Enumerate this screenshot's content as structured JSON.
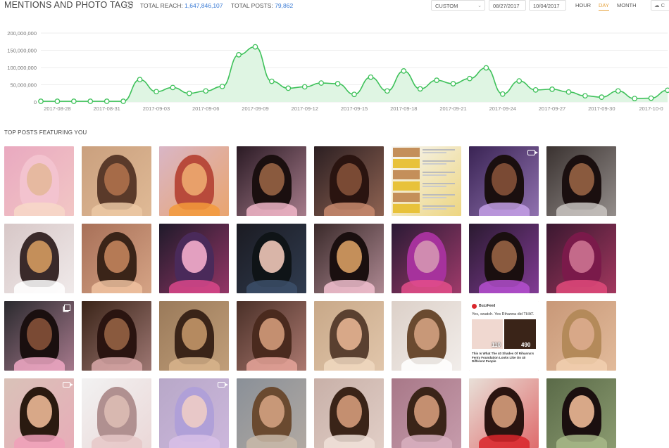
{
  "header": {
    "title": "MENTIONS AND PHOTO TAGS",
    "info_icon": "info-icon",
    "total_reach_label": "TOTAL REACH:",
    "total_reach_value": "1,647,846,107",
    "total_posts_label": "TOTAL POSTS:",
    "total_posts_value": "79,862",
    "range_select": "CUSTOM",
    "date_from": "08/27/2017",
    "date_to": "10/04/2017",
    "granularity": [
      "HOUR",
      "DAY",
      "MONTH"
    ],
    "granularity_active": "DAY",
    "download_label": "C"
  },
  "colors": {
    "accent": "#e6a23c",
    "link": "#3a7bd5",
    "line": "#3ec15a",
    "fill": "#dff5e3"
  },
  "chart_data": {
    "type": "area",
    "title": "",
    "xlabel": "",
    "ylabel": "",
    "ylim": [
      0,
      200000000
    ],
    "yticks": [
      "0",
      "50,000,000",
      "100,000,000",
      "150,000,000",
      "200,000,000"
    ],
    "ytick_values": [
      0,
      50000000,
      100000000,
      150000000,
      200000000
    ],
    "x": [
      "2017-08-27",
      "2017-08-28",
      "2017-08-29",
      "2017-08-30",
      "2017-08-31",
      "2017-09-01",
      "2017-09-02",
      "2017-09-03",
      "2017-09-04",
      "2017-09-05",
      "2017-09-06",
      "2017-09-07",
      "2017-09-08",
      "2017-09-09",
      "2017-09-10",
      "2017-09-11",
      "2017-09-12",
      "2017-09-13",
      "2017-09-14",
      "2017-09-15",
      "2017-09-16",
      "2017-09-17",
      "2017-09-18",
      "2017-09-19",
      "2017-09-20",
      "2017-09-21",
      "2017-09-22",
      "2017-09-23",
      "2017-09-24",
      "2017-09-25",
      "2017-09-26",
      "2017-09-27",
      "2017-09-28",
      "2017-09-29",
      "2017-09-30",
      "2017-10-01",
      "2017-10-02",
      "2017-10-03",
      "2017-10-04"
    ],
    "xtick_labels": [
      "2017-08-28",
      "2017-08-31",
      "2017-09-03",
      "2017-09-06",
      "2017-09-09",
      "2017-09-12",
      "2017-09-15",
      "2017-09-18",
      "2017-09-21",
      "2017-09-24",
      "2017-09-27",
      "2017-09-30",
      "2017-10-0"
    ],
    "series": [
      {
        "values": [
          2000000,
          2000000,
          2000000,
          2000000,
          2000000,
          2000000,
          65000000,
          30000000,
          42000000,
          25000000,
          32000000,
          45000000,
          137000000,
          160000000,
          60000000,
          40000000,
          44000000,
          55000000,
          53000000,
          22000000,
          72000000,
          32000000,
          90000000,
          38000000,
          63000000,
          53000000,
          68000000,
          99000000,
          23000000,
          61000000,
          35000000,
          37000000,
          29000000,
          18000000,
          14000000,
          32000000,
          10000000,
          11000000,
          34000000
        ]
      }
    ],
    "grid": true,
    "legend": "none"
  },
  "section": {
    "title": "TOP POSTS FEATURING YOU"
  },
  "posts": [
    {
      "label": "post-1",
      "bg": "#e9a9c0",
      "accent": "#f7d8c8",
      "skin": "#e6b9a0",
      "hair": "#f3c3cf",
      "badge": ""
    },
    {
      "label": "post-2",
      "bg": "#caa07e",
      "accent": "#ecc9a4",
      "skin": "#a66b48",
      "hair": "#5a3a2a",
      "badge": ""
    },
    {
      "label": "post-3",
      "bg": "#d9b6c6",
      "accent": "#f39a3b",
      "skin": "#e8a06a",
      "hair": "#b84a3b",
      "badge": ""
    },
    {
      "label": "post-4",
      "bg": "#2a1a24",
      "accent": "#f1b6c8",
      "skin": "#8a5a3e",
      "hair": "#1a0f0f",
      "badge": ""
    },
    {
      "label": "post-5",
      "bg": "#2c1f22",
      "accent": "#c98b6e",
      "skin": "#7a4a34",
      "hair": "#2a1410",
      "badge": ""
    },
    {
      "label": "post-6",
      "bg": "#f6f6f6",
      "accent": "#e8c23a",
      "skin": "#c48f5a",
      "hair": "#8b5a2b",
      "badge": "list"
    },
    {
      "label": "post-7",
      "bg": "#3a2454",
      "accent": "#c4a0e6",
      "skin": "#7a4a34",
      "hair": "#1a0f0f",
      "badge": "cam"
    },
    {
      "label": "post-8",
      "bg": "#3a3230",
      "accent": "#c9c4c1",
      "skin": "#8a5a3e",
      "hair": "#1a0f0f",
      "badge": ""
    },
    {
      "label": "post-9",
      "bg": "#d7c7c7",
      "accent": "#ffffff",
      "skin": "#c48f5a",
      "hair": "#3a2a2a",
      "badge": ""
    },
    {
      "label": "post-10",
      "bg": "#a87058",
      "accent": "#f0c2a0",
      "skin": "#b57a55",
      "hair": "#3a2418",
      "badge": ""
    },
    {
      "label": "post-11",
      "bg": "#1f1a2a",
      "accent": "#d9468a",
      "skin": "#e3a0c0",
      "hair": "#4a2a5a",
      "badge": ""
    },
    {
      "label": "post-12",
      "bg": "#1b1b22",
      "accent": "#3c4f6a",
      "skin": "#d9b5a8",
      "hair": "#0f1417",
      "badge": ""
    },
    {
      "label": "post-13",
      "bg": "#3a2a2a",
      "accent": "#f3c1d0",
      "skin": "#c48f5a",
      "hair": "#1a0f0f",
      "badge": ""
    },
    {
      "label": "post-14",
      "bg": "#2a1a35",
      "accent": "#e44e8a",
      "skin": "#d08bb0",
      "hair": "#a6329c",
      "badge": ""
    },
    {
      "label": "post-15",
      "bg": "#2a1a30",
      "accent": "#b54fd0",
      "skin": "#8a5a3e",
      "hair": "#1a0f0f",
      "badge": ""
    },
    {
      "label": "post-16",
      "bg": "#3a1830",
      "accent": "#e04a7a",
      "skin": "#c46a8a",
      "hair": "#7a1a4a",
      "badge": ""
    },
    {
      "label": "post-17",
      "bg": "#2a2a2e",
      "accent": "#f0a8c4",
      "skin": "#7a4a34",
      "hair": "#1a0f0f",
      "badge": "multi"
    },
    {
      "label": "post-18",
      "bg": "#3a2418",
      "accent": "#d9a8a8",
      "skin": "#8a5a3e",
      "hair": "#2a1410",
      "badge": ""
    },
    {
      "label": "post-19",
      "bg": "#9a7a5a",
      "accent": "#d8b48c",
      "skin": "#b58a60",
      "hair": "#3a2418",
      "badge": ""
    },
    {
      "label": "post-20",
      "bg": "#4a3028",
      "accent": "#e6a49a",
      "skin": "#c48f70",
      "hair": "#4a2a1e",
      "badge": ""
    },
    {
      "label": "post-21",
      "bg": "#c8a888",
      "accent": "#f0d8c0",
      "skin": "#d8a888",
      "hair": "#5a4030",
      "badge": ""
    },
    {
      "label": "post-22",
      "bg": "#dcd0c8",
      "accent": "#ffffff",
      "skin": "#c89878",
      "hair": "#6a4a30",
      "badge": ""
    },
    {
      "label": "post-23",
      "bg": "#ffffff",
      "accent": "#d9262c",
      "skin": "#7a4a34",
      "hair": "#1a0f0f",
      "badge": "card"
    },
    {
      "label": "post-24",
      "bg": "#c89878",
      "accent": "#f2d0b0",
      "skin": "#d8a888",
      "hair": "#b48a5a",
      "badge": ""
    },
    {
      "label": "post-25",
      "bg": "#d9c2b8",
      "accent": "#f0a0b8",
      "skin": "#d8a888",
      "hair": "#2a1a10",
      "badge": "cam"
    },
    {
      "label": "post-26",
      "bg": "#f2f2f2",
      "accent": "#e6c8c8",
      "skin": "#d8b8b0",
      "hair": "#b09090",
      "badge": ""
    },
    {
      "label": "post-27",
      "bg": "#b8a8c8",
      "accent": "#d8c0e8",
      "skin": "#e8c8c8",
      "hair": "#b0a0d8",
      "badge": "cam"
    },
    {
      "label": "post-28",
      "bg": "#8a9098",
      "accent": "#c8b8a8",
      "skin": "#c89878",
      "hair": "#6a4a30",
      "badge": ""
    },
    {
      "label": "post-29",
      "bg": "#c8b0a8",
      "accent": "#f0e0d8",
      "skin": "#c48f70",
      "hair": "#3a2418",
      "badge": ""
    },
    {
      "label": "post-30",
      "bg": "#a87888",
      "accent": "#d8b0c0",
      "skin": "#c48f70",
      "hair": "#3a2418",
      "badge": ""
    },
    {
      "label": "post-31",
      "bg": "#e8e0d8",
      "accent": "#d9262c",
      "skin": "#c48f70",
      "hair": "#2a1410",
      "badge": ""
    },
    {
      "label": "post-32",
      "bg": "#5a6a48",
      "accent": "#a8b888",
      "skin": "#d8a888",
      "hair": "#1a0f0f",
      "badge": ""
    }
  ],
  "card_post": {
    "source": "BuzzFeed",
    "headline": "Yes, swatch. Yes Rihanna did THAT.",
    "left_num": "110",
    "right_num": "490",
    "caption": "This Is What The 40 Shades Of Rihanna's Fenty Foundation Looks Like On 40 Different People"
  }
}
